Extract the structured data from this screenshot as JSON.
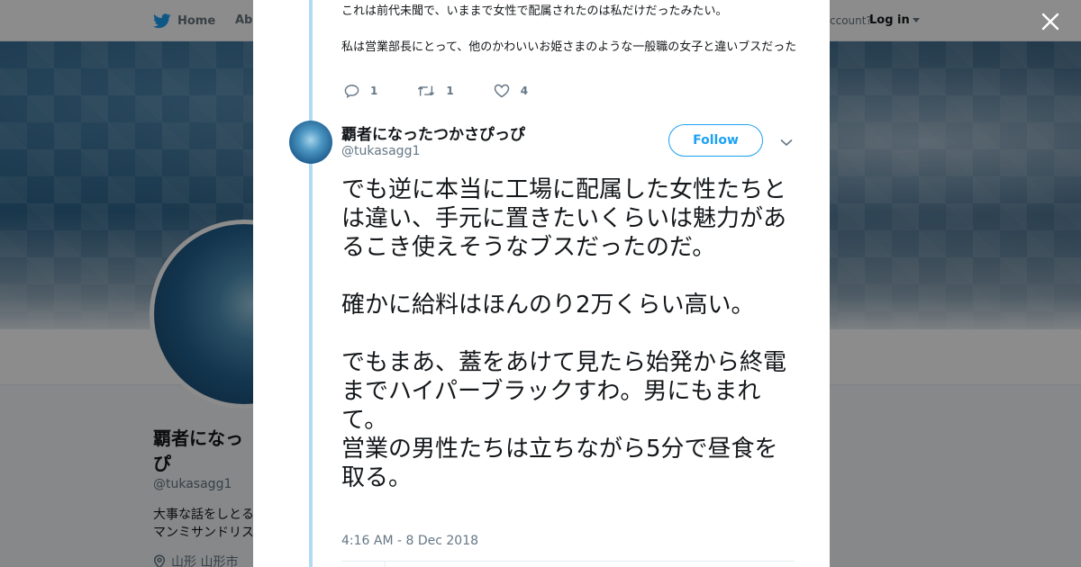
{
  "topnav": {
    "home_label": "Home",
    "about_label": "Abo",
    "account_text": "ccount?",
    "login_label": "Log in"
  },
  "profile": {
    "name": "覇者になっ",
    "name_line2": "ぴ",
    "handle": "@tukasagg1",
    "bio_line1": "大事な話をしとる",
    "bio_line2": "マンミサンドリス",
    "location": "山形 山形市"
  },
  "modal": {
    "previous_tweet": {
      "lines": [
        "これは前代未聞で、いままで女性で配属されたのは私だけだったみたい。",
        "私は営業部長にとって、他のかわいいお姫さまのような一般職の女子と違いブスだった"
      ],
      "reply_count": "1",
      "retweet_count": "1",
      "like_count": "4"
    },
    "tweet": {
      "author_name": "覇者になったつかさぴっぴ",
      "author_handle": "@tukasagg1",
      "follow_label": "Follow",
      "paragraphs": [
        "でも逆に本当に工場に配属した女性たちとは違い、手元に置きたいくらいは魅力があるこき使えそうなブスだったのだ。",
        "確かに給料はほんのり2万くらい高い。",
        "でもまあ、蓋をあけて見たら始発から終電までハイパーブラックすわ。男にもまれて。\n営業の男性たちは立ちながら5分で昼食を取る。"
      ],
      "timestamp": "4:16 AM - 8 Dec 2018"
    }
  },
  "colors": {
    "accent": "#1da1f2",
    "thread_line": "#b1dbf5",
    "text": "#14171a",
    "muted": "#657786"
  },
  "icons": {
    "home": "twitter-bird-icon",
    "close": "close-icon",
    "reply": "reply-icon",
    "retweet": "retweet-icon",
    "like": "heart-icon",
    "more": "chevron-down-icon",
    "location": "location-pin-icon"
  }
}
